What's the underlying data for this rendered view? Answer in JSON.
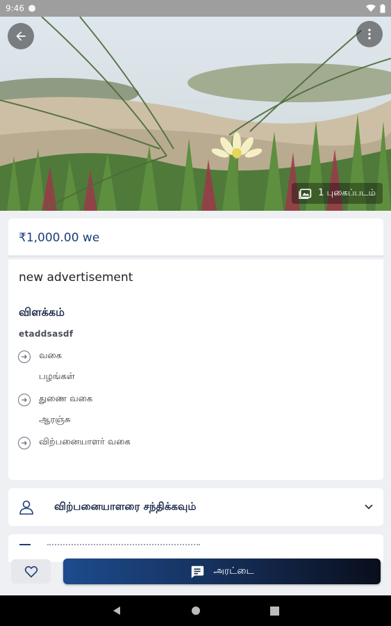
{
  "status_bar": {
    "time": "9:46"
  },
  "hero": {
    "photo_count_label": "1 புகைப்படம்",
    "icons": {
      "back": "arrow-back-icon",
      "more": "more-vert-icon",
      "photos": "photo-library-icon"
    }
  },
  "listing": {
    "price": "₹1,000.00 we",
    "title": "new advertisement",
    "description_heading": "விளக்கம்",
    "description": "etaddsasdf",
    "attributes": [
      {
        "label": "வகை",
        "value": "பழங்கள்"
      },
      {
        "label": "துணை வகை",
        "value": "ஆரஞ்சு"
      },
      {
        "label": "விற்பனையாளர் வகை",
        "value": ""
      }
    ]
  },
  "seller": {
    "label": "விற்பனையாளரை சந்திக்கவும்"
  },
  "actions": {
    "chat_label": "அரட்டை"
  },
  "colors": {
    "accent": "#1c3d7a",
    "chat_gradient_start": "#1d4b8d",
    "chat_gradient_end": "#0a0e1c"
  }
}
